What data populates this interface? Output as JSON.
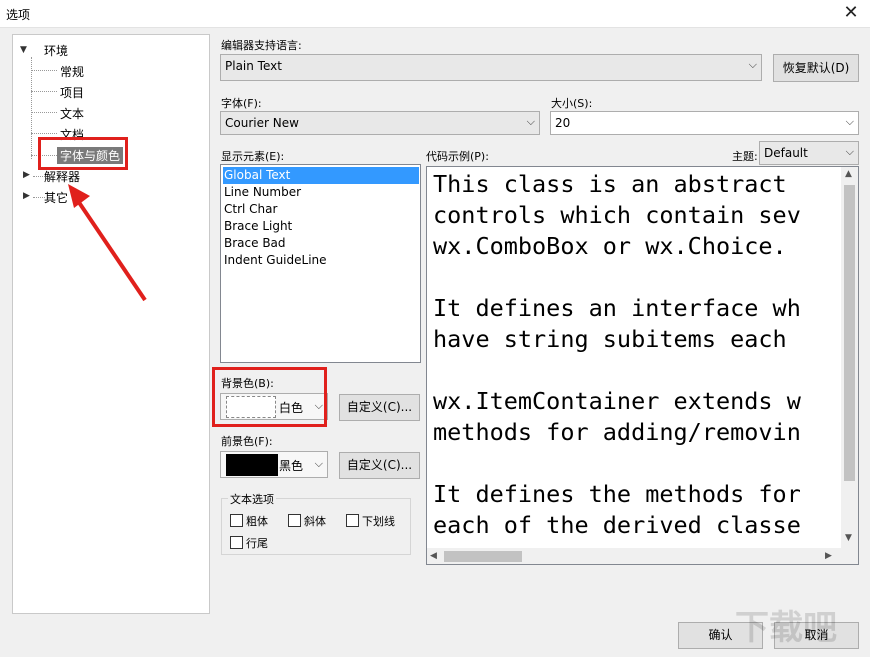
{
  "window": {
    "title": "选项",
    "close_glyph": "✕"
  },
  "tree": {
    "root": "环境",
    "children": [
      "常规",
      "项目",
      "文本",
      "文档",
      "字体与颜色"
    ],
    "other_nodes": [
      "解释器",
      "其它"
    ]
  },
  "editor_lang": {
    "label": "编辑器支持语言:",
    "value": "Plain Text",
    "reset_button": "恢复默认(D)"
  },
  "font": {
    "label": "字体(F):",
    "value": "Courier New"
  },
  "size": {
    "label": "大小(S):",
    "value": "20"
  },
  "display_elements": {
    "label": "显示元素(E):",
    "items": [
      "Global Text",
      "Line Number",
      "Ctrl Char",
      "Brace Light",
      "Brace Bad",
      "Indent GuideLine"
    ],
    "selected": "Global Text"
  },
  "code_sample": {
    "label": "代码示例(P):",
    "lines": [
      "This class is an abstract",
      "controls which contain sev",
      "wx.ComboBox or wx.Choice.",
      "",
      "It defines an interface wh",
      "have string subitems each",
      "",
      "wx.ItemContainer extends w",
      "methods for adding/removin",
      "",
      "It defines the methods for",
      "each of the derived classe"
    ]
  },
  "theme": {
    "label": "主题:",
    "value": "Default"
  },
  "background": {
    "label": "背景色(B):",
    "color_name": "白色",
    "custom_button": "自定义(C)...",
    "color": "#ffffff"
  },
  "foreground": {
    "label": "前景色(F):",
    "color_name": "黑色",
    "custom_button": "自定义(C)...",
    "color": "#000000"
  },
  "text_options": {
    "label": "文本选项",
    "bold": "粗体",
    "italic": "斜体",
    "underline": "下划线",
    "eol": "行尾"
  },
  "footer": {
    "ok": "确认",
    "cancel": "取消"
  },
  "watermark": "下载吧",
  "colors": {
    "highlight": "#e0201c",
    "selection": "#3399ff"
  }
}
